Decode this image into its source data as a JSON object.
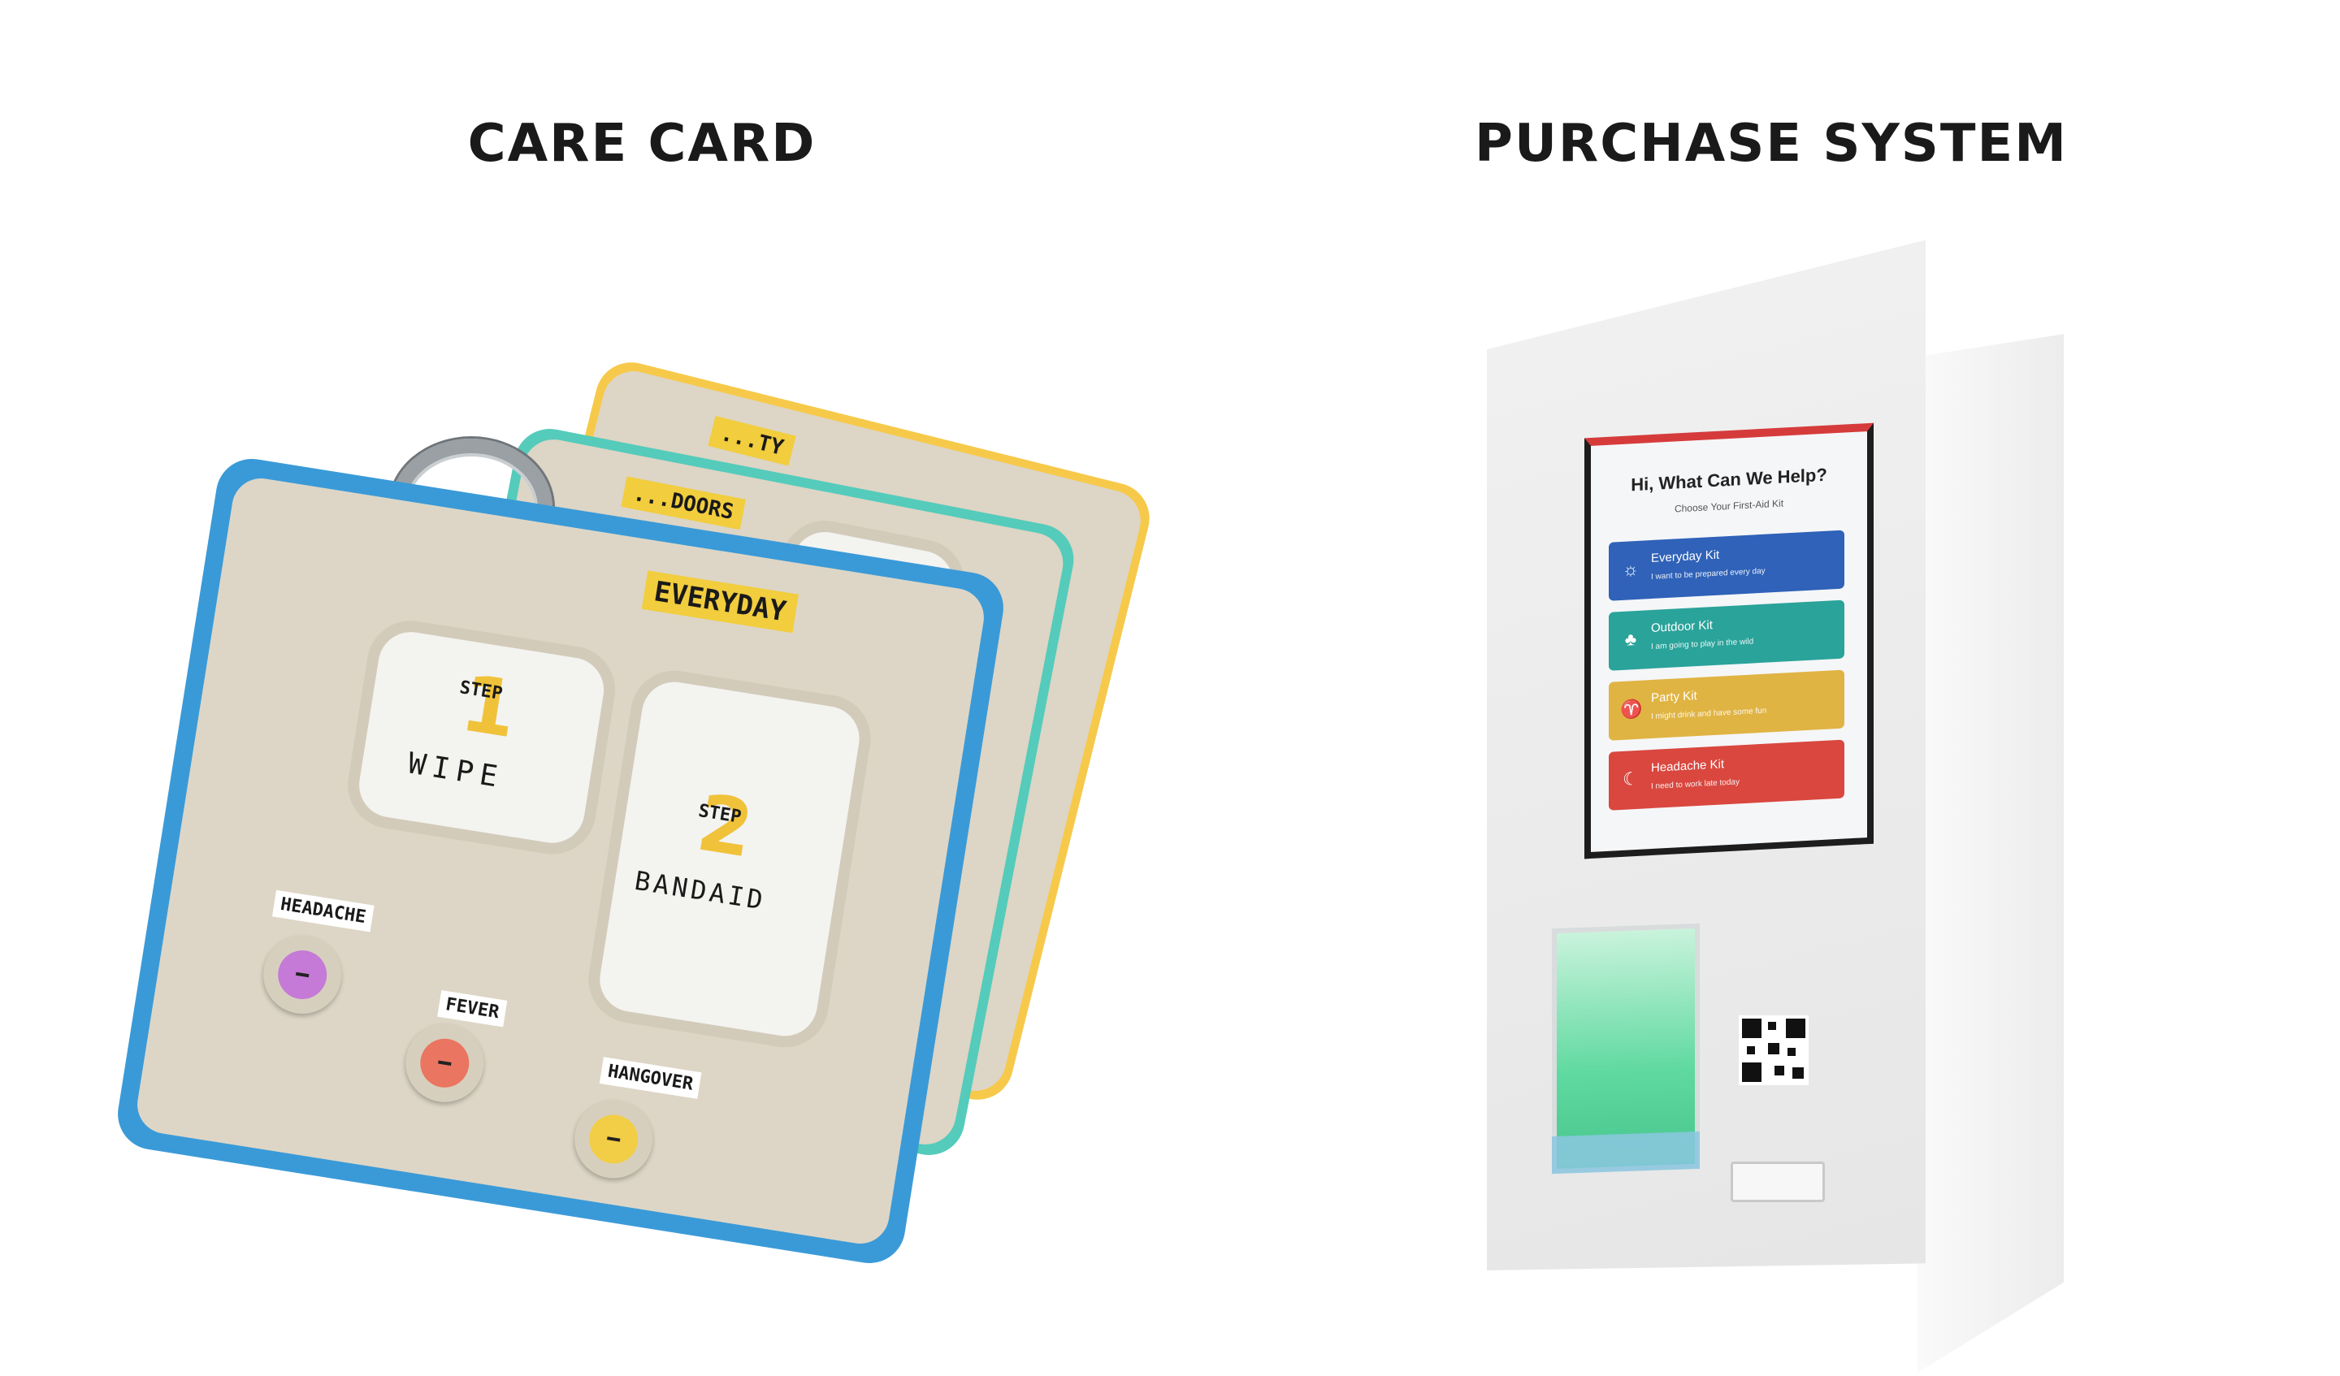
{
  "headings": {
    "care_card": "CARE CARD",
    "purchase_system": "PURCHASE SYSTEM"
  },
  "care_card_photo": {
    "tags": {
      "back_card": "...TY",
      "middle_card": "...DOORS",
      "front_card": "EVERYDAY"
    },
    "steps": [
      {
        "step_word": "STEP",
        "number": "1",
        "action": "WIPE"
      },
      {
        "step_word": "STEP",
        "number": "2",
        "action": "BANDAID"
      }
    ],
    "symptom_buttons": [
      {
        "label": "HEADACHE",
        "color": "#c47ad6"
      },
      {
        "label": "FEVER",
        "color": "#ea7560"
      },
      {
        "label": "HANGOVER",
        "color": "#f1ce45"
      }
    ],
    "colors": {
      "front_card": "#3a9ad8",
      "middle_card": "#55cbbb",
      "back_card": "#f7c94a"
    }
  },
  "purchase_system_photo": {
    "screen": {
      "title": "Hi, What Can We Help?",
      "subtitle": "Choose Your First-Aid Kit",
      "kits": [
        {
          "name": "Everyday Kit",
          "description": "I want to be prepared every day",
          "color": "#2f62b8",
          "icon": "sun-icon",
          "glyph": "☼"
        },
        {
          "name": "Outdoor Kit",
          "description": "I am going to play in the wild",
          "color": "#2aa39a",
          "icon": "tree-icon",
          "glyph": "♣"
        },
        {
          "name": "Party Kit",
          "description": "I might drink and have some fun",
          "color": "#e0b443",
          "icon": "glass-icon",
          "glyph": "♈"
        },
        {
          "name": "Headache Kit",
          "description": "I need to work late today",
          "color": "#d9473f",
          "icon": "moon-icon",
          "glyph": "☾"
        }
      ]
    }
  }
}
